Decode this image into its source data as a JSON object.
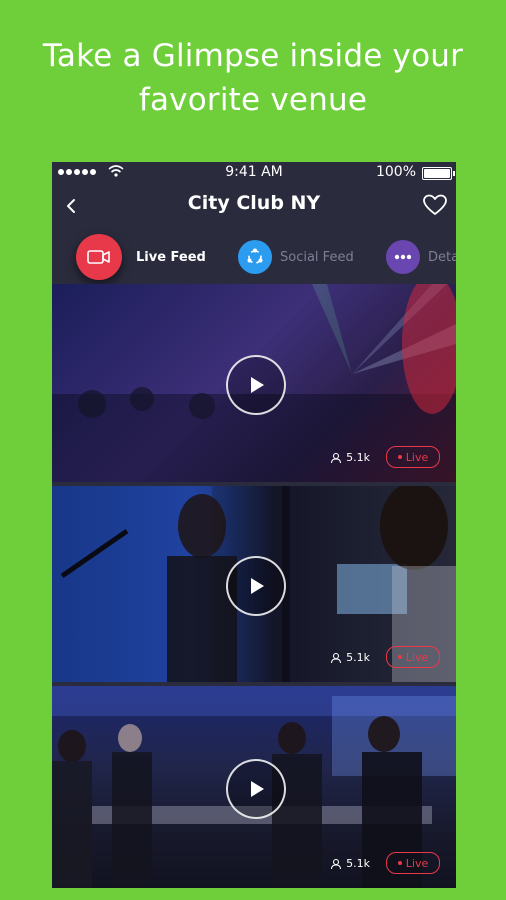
{
  "promo": {
    "line1": "Take a Glimpse inside your",
    "line2": "favorite venue"
  },
  "status_bar": {
    "time": "9:41 AM",
    "battery": "100%"
  },
  "nav": {
    "title": "City Club NY"
  },
  "tabs": [
    {
      "label": "Live Feed",
      "icon": "video-camera-icon",
      "color": "#e8394a",
      "active": true
    },
    {
      "label": "Social Feed",
      "icon": "share-icon",
      "color": "#2b9cf0",
      "active": false
    },
    {
      "label": "Deta",
      "icon": "more-dots-icon",
      "color": "#6a46b0",
      "active": false
    }
  ],
  "feed": [
    {
      "viewers": "5.1k",
      "badge": "Live"
    },
    {
      "viewers": "5.1k",
      "badge": "Live"
    },
    {
      "viewers": "5.1k",
      "badge": "Live"
    }
  ],
  "colors": {
    "background": "#6fcf3a",
    "phone_bg": "#2a2b3c",
    "accent_red": "#e8394a",
    "accent_blue": "#2b9cf0",
    "accent_purple": "#6a46b0"
  }
}
